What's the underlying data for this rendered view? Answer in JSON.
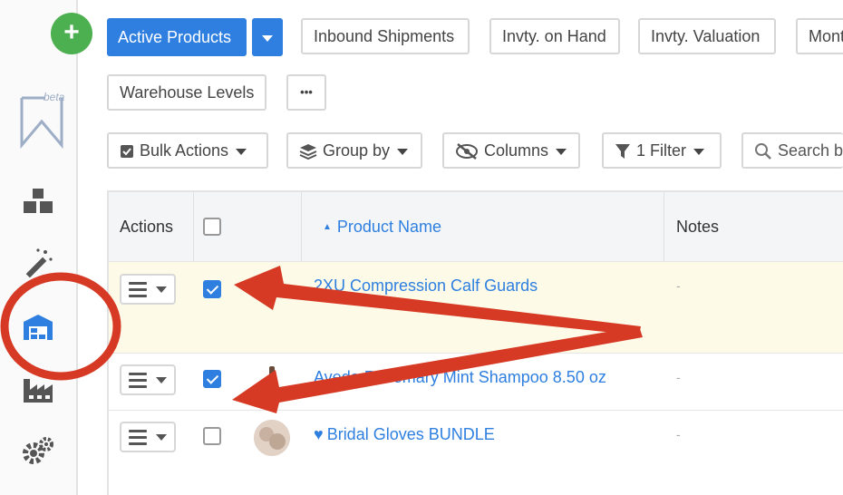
{
  "sidebar": {
    "add_label": "+",
    "beta_label": "beta"
  },
  "toolbar": {
    "row1": {
      "active_products": "Active Products",
      "inbound_shipments": "Inbound Shipments",
      "inventory_on_hand": "Invty. on Hand",
      "inventory_valuation": "Invty. Valuation",
      "monthly_truncated": "Mont"
    },
    "row2": {
      "warehouse_levels": "Warehouse Levels",
      "more": "•••"
    },
    "row3": {
      "bulk_actions": "Bulk Actions",
      "group_by": "Group by",
      "columns": "Columns",
      "filter": "1 Filter",
      "search_placeholder": "Search b"
    }
  },
  "table": {
    "headers": {
      "actions": "Actions",
      "product_name": "Product Name",
      "notes": "Notes"
    },
    "rows": [
      {
        "name": "2XU Compression Calf Guards",
        "note": "-",
        "checked": true
      },
      {
        "name": "Aveda Rosemary Mint Shampoo 8.50 oz",
        "note": "-",
        "checked": true
      },
      {
        "name": "Bridal Gloves BUNDLE",
        "note": "-",
        "checked": false
      }
    ]
  },
  "colors": {
    "primary": "#2e7fe0",
    "add_button": "#4caf50",
    "annotation": "#d63a24",
    "selected_row": "#fdfbe8"
  }
}
